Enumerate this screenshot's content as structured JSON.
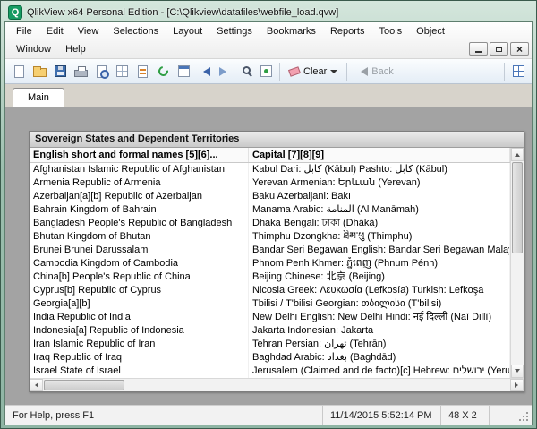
{
  "window": {
    "title": "QlikView x64 Personal Edition - [C:\\Qlikview\\datafiles\\webfile_load.qvw]",
    "icon_glyph": "Q"
  },
  "colors": {
    "brand_green": "#169b62"
  },
  "menu": {
    "row1": [
      "File",
      "Edit",
      "View",
      "Selections",
      "Layout",
      "Settings",
      "Bookmarks",
      "Reports",
      "Tools",
      "Object"
    ],
    "row2": [
      "Window",
      "Help"
    ]
  },
  "toolbar": {
    "icons": [
      "new-document",
      "open-file",
      "save",
      "print",
      "print-preview",
      "edit-layout",
      "edit-script",
      "reload",
      "table-viewer",
      "undo",
      "redo",
      "search",
      "current-selections"
    ],
    "clear_label": "Clear",
    "back_label": "Back",
    "right_icons": [
      "design-grid"
    ]
  },
  "tabs": [
    {
      "label": "Main"
    }
  ],
  "table": {
    "caption": "Sovereign States and Dependent Territories",
    "columns": [
      "English short and formal names [5][6]...",
      "Capital [7][8][9]"
    ],
    "rows": [
      [
        "Afghanistan Islamic Republic of Afghanistan",
        "Kabul Dari: كابل (Kābul) Pashto: كابل (Kābul)"
      ],
      [
        "Armenia Republic of Armenia",
        "Yerevan Armenian: Երևան (Yerevan)"
      ],
      [
        "Azerbaijan[a][b] Republic of Azerbaijan",
        "Baku Azerbaijani: Bakı"
      ],
      [
        "Bahrain Kingdom of Bahrain",
        "Manama Arabic: المنامة (Al Manāmah)"
      ],
      [
        "Bangladesh People's Republic of Bangladesh",
        "Dhaka Bengali: ঢাকা (Dhākā)"
      ],
      [
        "Bhutan Kingdom of Bhutan",
        "Thimphu  Dzongkha: ཐིམ་ཕུ (Thimphu)"
      ],
      [
        "Brunei Brunei Darussalam",
        "Bandar Seri Begawan English: Bandar Seri Begawan Malay: B"
      ],
      [
        "Cambodia Kingdom of Cambodia",
        "Phnom Penh Khmer: ភ្នំពេញ (Phnum Pénh)"
      ],
      [
        "China[b] People's Republic of China",
        "Beijing  Chinese: 北京 (Beijing)"
      ],
      [
        "Cyprus[b] Republic of Cyprus",
        "Nicosia Greek: Λευκωσία (Lefkosía) Turkish: Lefkoşa"
      ],
      [
        "Georgia[a][b]",
        "Tbilisi / T'bilisi Georgian: თბილისი (T'bilisi)"
      ],
      [
        "India Republic of India",
        "New Delhi English: New Delhi Hindi: नई दिल्ली (Naī Dillī)"
      ],
      [
        "Indonesia[a] Republic of Indonesia",
        "Jakarta Indonesian: Jakarta"
      ],
      [
        "Iran Islamic Republic of Iran",
        "Tehran Persian: تهران (Tehrān)"
      ],
      [
        "Iraq Republic of Iraq",
        "Baghdad Arabic: بغداد (Baghdād)"
      ],
      [
        "Israel State of Israel",
        "Jerusalem (Claimed and de facto)[c] Hebrew: ירושלים (Yeru"
      ]
    ]
  },
  "status": {
    "help_text": "For Help, press F1",
    "datetime": "11/14/2015 5:52:14 PM",
    "dimensions": "48 X 2"
  }
}
